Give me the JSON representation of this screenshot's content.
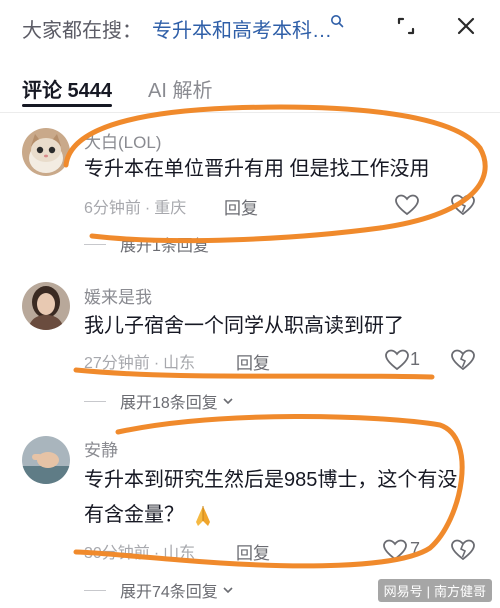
{
  "search": {
    "prefix": "大家都在搜：",
    "query": "专升本和高考本科…"
  },
  "tabs": {
    "comments": "评论 5444",
    "ai": "AI 解析"
  },
  "comments": [
    {
      "user": "大白(LOL)",
      "text": "专升本在单位晋升有用 但是找工作没用",
      "time": "6分钟前",
      "location": "重庆",
      "reply": "回复",
      "expand": "展开1条回复"
    },
    {
      "user": "媛来是我",
      "text": "我儿子宿舍一个同学从职高读到研了",
      "time": "27分钟前",
      "location": "山东",
      "reply": "回复",
      "likes": "1",
      "expand": "展开18条回复"
    },
    {
      "user": "安静",
      "text_line1": "专升本到研究生然后是985博士，这个有没",
      "text_line2": "有含金量？",
      "time": "30分钟前",
      "location": "山东",
      "reply": "回复",
      "likes": "7",
      "expand": "展开74条回复"
    }
  ],
  "watermark": {
    "left": "网易号",
    "right": "南方健哥"
  },
  "colors": {
    "annotation": "#f08a2c",
    "query_link": "#2f5fa8"
  }
}
